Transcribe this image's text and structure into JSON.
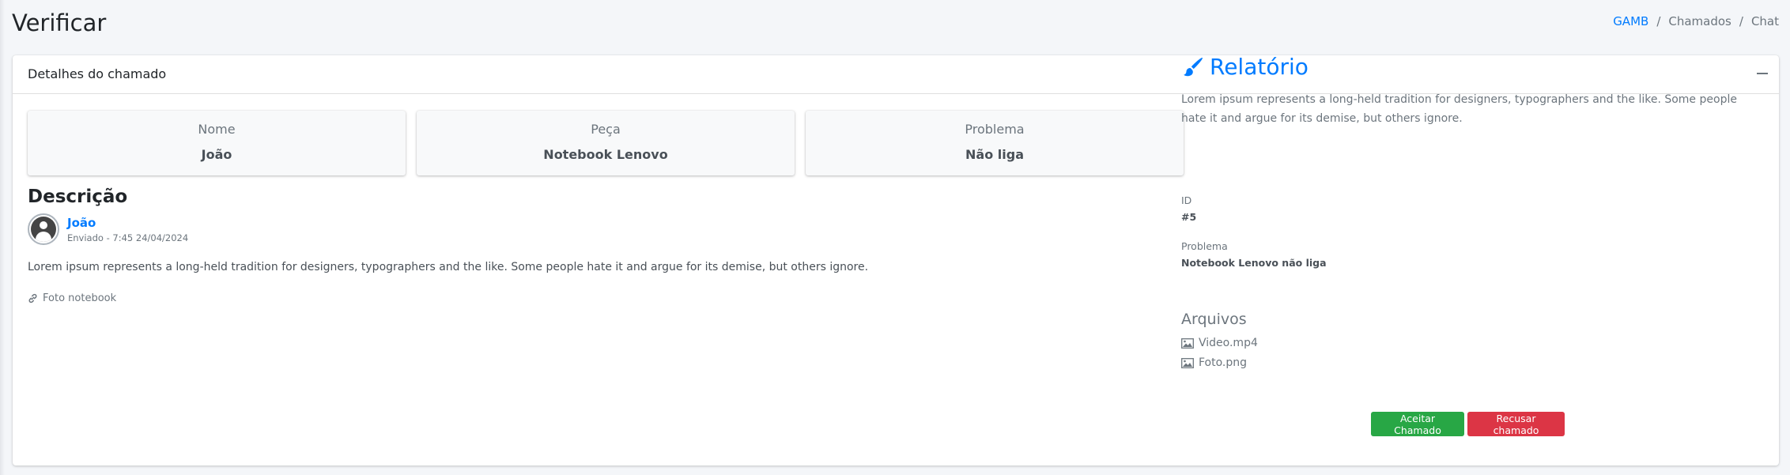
{
  "page": {
    "title": "Verificar"
  },
  "breadcrumb": {
    "items": [
      "GAMB",
      "Chamados",
      "Chat"
    ]
  },
  "card": {
    "title": "Detalhes do chamado"
  },
  "info_boxes": [
    {
      "label": "Nome",
      "value": "João"
    },
    {
      "label": "Peça",
      "value": "Notebook Lenovo"
    },
    {
      "label": "Problema",
      "value": "Não liga"
    }
  ],
  "description": {
    "title": "Descrição",
    "user_name": "João",
    "meta": "Enviado - 7:45 24/04/2024",
    "text": "Lorem ipsum represents a long-held tradition for designers, typographers and the like. Some people hate it and argue for its demise, but others ignore.",
    "attachment": "Foto notebook"
  },
  "report": {
    "title": "Relatório",
    "text": "Lorem ipsum represents a long-held tradition for designers, typographers and the like. Some people hate it and argue for its demise, but others ignore.",
    "id_label": "ID",
    "id_value": "#5",
    "problem_label": "Problema",
    "problem_value": "Notebook Lenovo não liga",
    "files_title": "Arquivos",
    "files": [
      "Video.mp4",
      "Foto.png"
    ]
  },
  "actions": {
    "accept": "Aceitar Chamado",
    "reject": "Recusar chamado"
  },
  "colors": {
    "primary": "#007bff",
    "success": "#28a745",
    "danger": "#dc3545",
    "background": "#f4f6f9"
  },
  "icons": {
    "collapse": "minus-icon",
    "report": "paintbrush-icon",
    "link": "link-icon",
    "file": "image-icon",
    "avatar": "user-icon"
  }
}
